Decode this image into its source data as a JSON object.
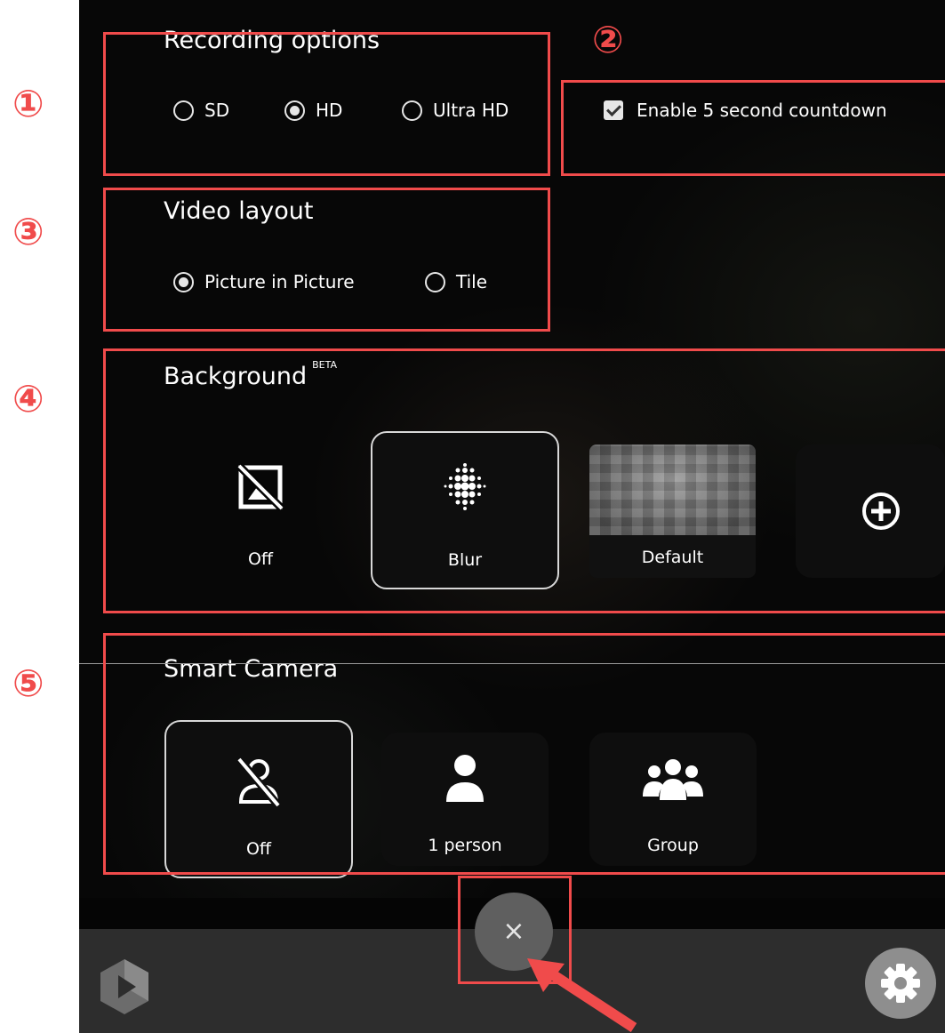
{
  "recording": {
    "title": "Recording options",
    "options": [
      {
        "label": "SD",
        "selected": false
      },
      {
        "label": "HD",
        "selected": true
      },
      {
        "label": "Ultra HD",
        "selected": false
      }
    ]
  },
  "countdown": {
    "label": "Enable 5 second countdown",
    "checked": true
  },
  "video_layout": {
    "title": "Video layout",
    "options": [
      {
        "label": "Picture in Picture",
        "selected": true
      },
      {
        "label": "Tile",
        "selected": false
      }
    ]
  },
  "background": {
    "title": "Background",
    "badge": "BETA",
    "options": [
      {
        "label": "Off",
        "icon": "image-off-icon",
        "selected": false
      },
      {
        "label": "Blur",
        "icon": "blur-icon",
        "selected": true
      },
      {
        "label": "Default",
        "icon": "background-thumbnail",
        "selected": false
      },
      {
        "label": "",
        "icon": "add-circle-icon",
        "selected": false
      }
    ]
  },
  "smart_camera": {
    "title": "Smart Camera",
    "options": [
      {
        "label": "Off",
        "icon": "person-off-icon",
        "selected": true
      },
      {
        "label": "1 person",
        "icon": "person-icon",
        "selected": false
      },
      {
        "label": "Group",
        "icon": "group-icon",
        "selected": false
      }
    ]
  },
  "close_button": {
    "glyph": "×"
  },
  "annotations": {
    "markers": [
      "①",
      "②",
      "③",
      "④",
      "⑤"
    ],
    "color": "#f04b4b"
  },
  "icons": {
    "logo": "app-logo-icon",
    "settings": "gear-icon",
    "close": "close-icon"
  }
}
